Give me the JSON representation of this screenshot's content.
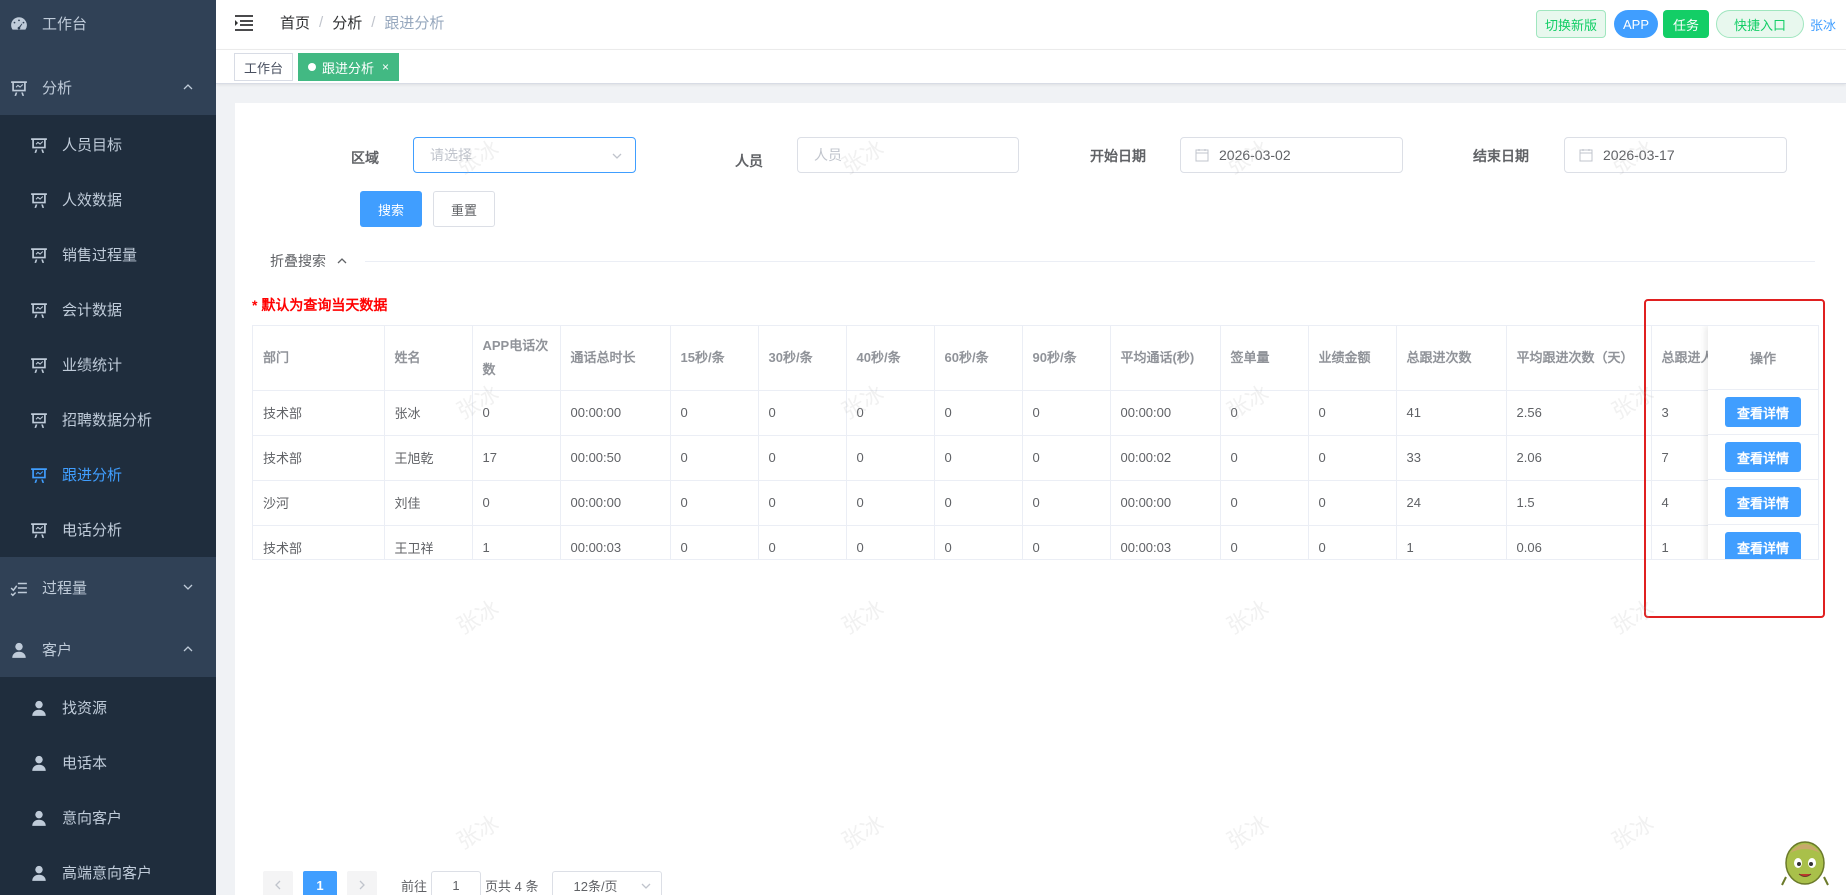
{
  "sidebar": {
    "workbench": "工作台",
    "analysis": "分析",
    "analysis_items": [
      "人员目标",
      "人效数据",
      "销售过程量",
      "会计数据",
      "业绩统计",
      "招聘数据分析",
      "跟进分析",
      "电话分析"
    ],
    "active_item": "跟进分析",
    "process": "过程量",
    "customer": "客户",
    "customer_items": [
      "找资源",
      "电话本",
      "意向客户",
      "高端意向客户"
    ]
  },
  "header": {
    "breadcrumb": [
      "首页",
      "分析",
      "跟进分析"
    ],
    "btn_new_version": "切换新版",
    "btn_app": "APP",
    "btn_task": "任务",
    "btn_quick": "快捷入口",
    "user": "张冰"
  },
  "tags": {
    "tag1": "工作台",
    "tag2": "跟进分析",
    "close": "×"
  },
  "filters": {
    "region_label": "区域",
    "region_placeholder": "请选择",
    "person_label": "人员",
    "person_placeholder": "人员",
    "start_label": "开始日期",
    "start_value": "2026-03-02",
    "end_label": "结束日期",
    "end_value": "2026-03-17",
    "search_btn": "搜索",
    "reset_btn": "重置",
    "fold": "折叠搜索"
  },
  "notice": "* 默认为查询当天数据",
  "table": {
    "headers": [
      "部门",
      "姓名",
      "APP电话次数",
      "通话总时长",
      "15秒/条",
      "30秒/条",
      "40秒/条",
      "60秒/条",
      "90秒/条",
      "平均通话(秒)",
      "签单量",
      "业绩金额",
      "总跟进次数",
      "平均跟进次数（天）",
      "总跟进人"
    ],
    "op_header": "操作",
    "op_btn": "查看详情",
    "rows": [
      [
        "技术部",
        "张冰",
        "0",
        "00:00:00",
        "0",
        "0",
        "0",
        "0",
        "0",
        "00:00:00",
        "0",
        "0",
        "41",
        "2.56",
        "3"
      ],
      [
        "技术部",
        "王旭乾",
        "17",
        "00:00:50",
        "0",
        "0",
        "0",
        "0",
        "0",
        "00:00:02",
        "0",
        "0",
        "33",
        "2.06",
        "7"
      ],
      [
        "沙河",
        "刘佳",
        "0",
        "00:00:00",
        "0",
        "0",
        "0",
        "0",
        "0",
        "00:00:00",
        "0",
        "0",
        "24",
        "1.5",
        "4"
      ],
      [
        "技术部",
        "王卫祥",
        "1",
        "00:00:03",
        "0",
        "0",
        "0",
        "0",
        "0",
        "00:00:03",
        "0",
        "0",
        "1",
        "0.06",
        "1"
      ]
    ]
  },
  "pagination": {
    "current": "1",
    "goto_prefix": "前往",
    "goto_value": "1",
    "goto_suffix": "页共 4 条",
    "page_size": "12条/页"
  },
  "watermark": "张冰"
}
